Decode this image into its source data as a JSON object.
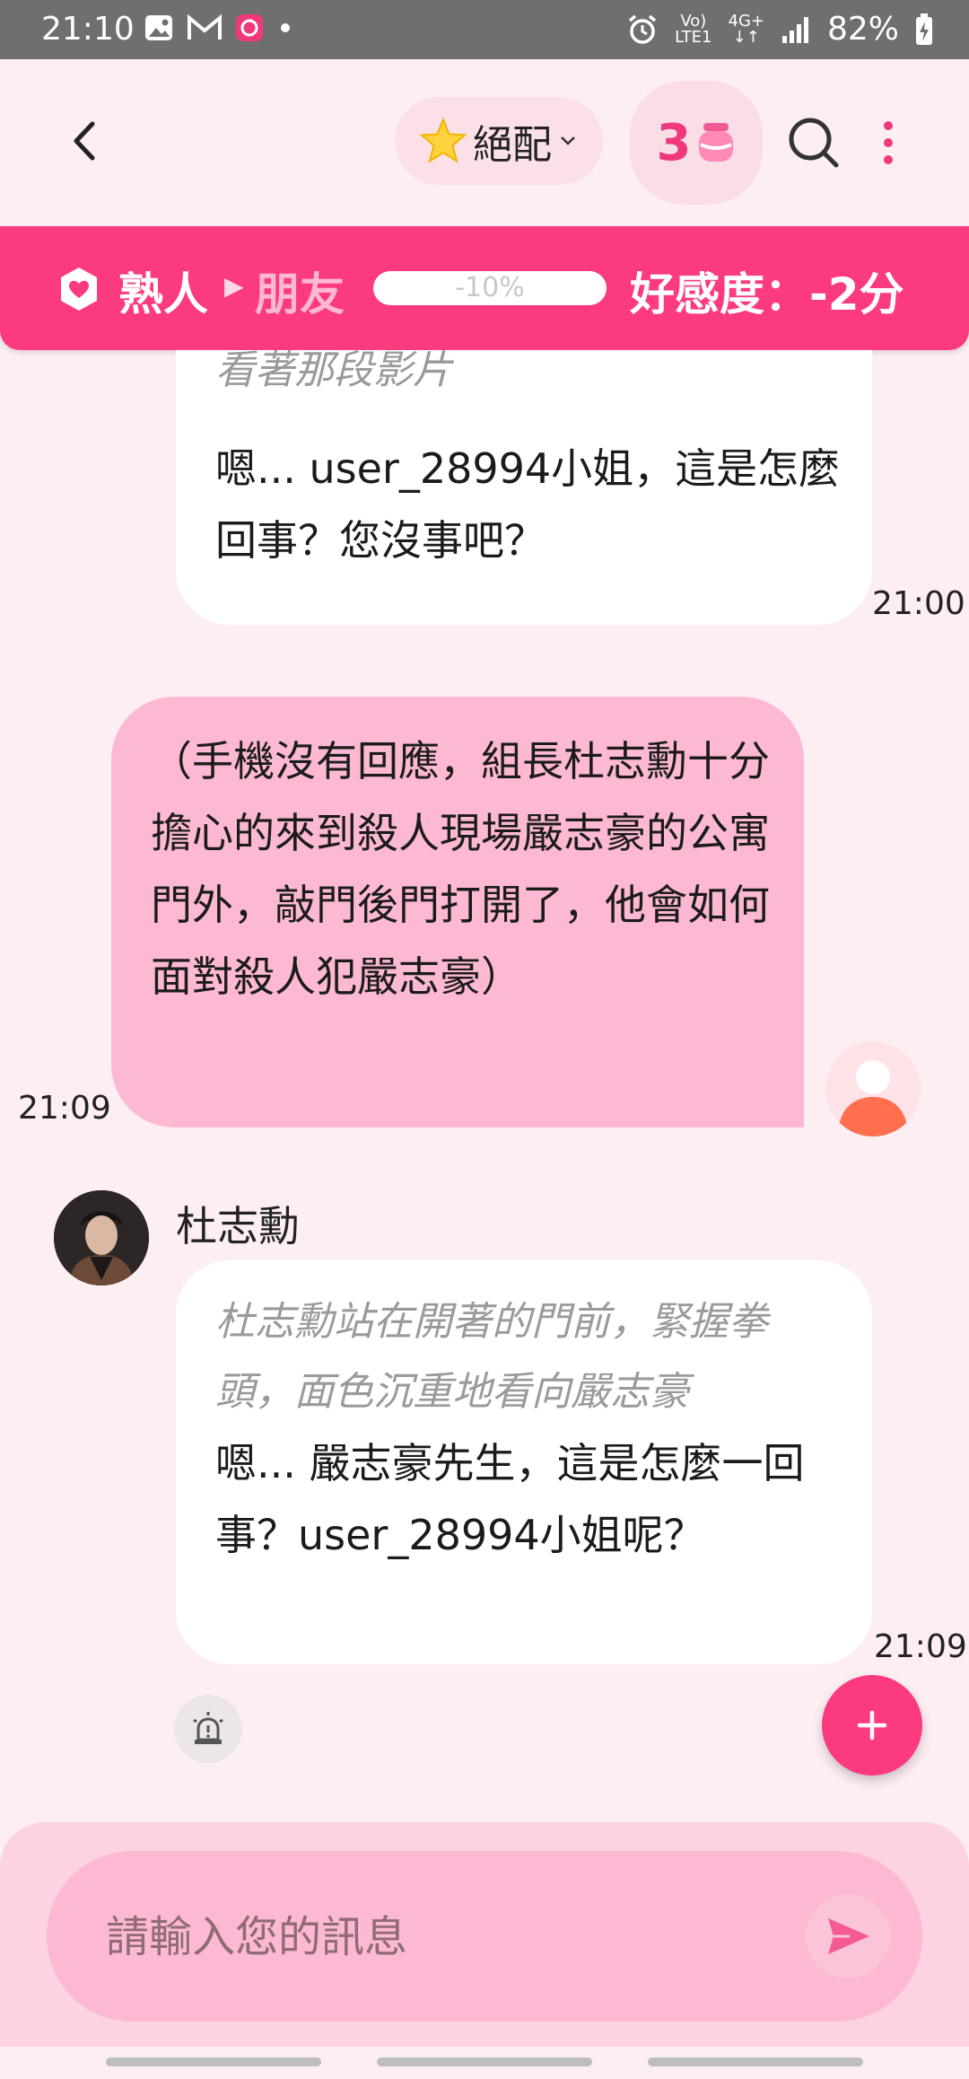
{
  "status_bar": {
    "time": "21:10",
    "network_top": "Vo)",
    "network_bottom": "LTE1",
    "data_top": "4G+",
    "data_bottom": "↓↑",
    "battery": "82%"
  },
  "header": {
    "match_label": "絕配",
    "coin_count": "3"
  },
  "relationship": {
    "from": "熟人",
    "to": "朋友",
    "progress_text": "-10%",
    "progress_fraction": 0.0,
    "score": "好感度：-2分"
  },
  "messages": [
    {
      "role": "ai",
      "action": "看著那段影片",
      "text": "嗯... user_28994小姐，這是怎麼回事？您沒事吧？",
      "time": "21:00"
    },
    {
      "role": "user",
      "text": "（手機沒有回應，組長杜志勳十分擔心的來到殺人現場嚴志豪的公寓門外，敲門後門打開了，他會如何面對殺人犯嚴志豪）",
      "time": "21:09"
    },
    {
      "role": "ai",
      "sender": "杜志勳",
      "action": "杜志勳站在開著的門前，緊握拳頭，面色沉重地看向嚴志豪",
      "text": "嗯... 嚴志豪先生，這是怎麼一回事？user_28994小姐呢？",
      "time": "21:09"
    }
  ],
  "input": {
    "placeholder": "請輸入您的訊息"
  },
  "colors": {
    "accent": "#fb3a7f",
    "background": "#fdeef2",
    "user_bubble": "#fdb9d3"
  }
}
